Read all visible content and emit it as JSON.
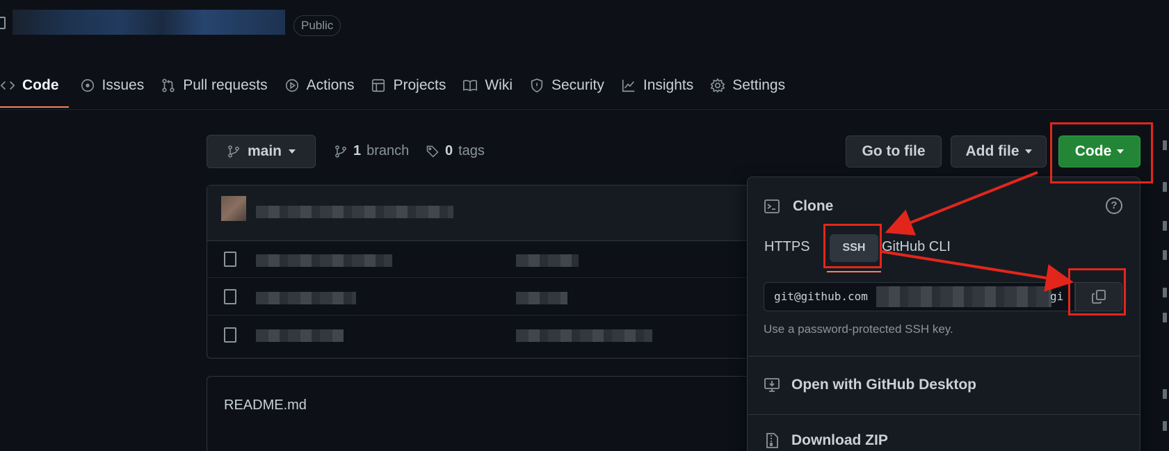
{
  "repo": {
    "visibility": "Public"
  },
  "tabs": [
    {
      "label": "Code",
      "icon": "code-icon",
      "active": true
    },
    {
      "label": "Issues",
      "icon": "issue-circle-icon"
    },
    {
      "label": "Pull requests",
      "icon": "pull-request-icon"
    },
    {
      "label": "Actions",
      "icon": "play-icon"
    },
    {
      "label": "Projects",
      "icon": "table-icon"
    },
    {
      "label": "Wiki",
      "icon": "book-icon"
    },
    {
      "label": "Security",
      "icon": "shield-icon"
    },
    {
      "label": "Insights",
      "icon": "graph-icon"
    },
    {
      "label": "Settings",
      "icon": "gear-icon"
    }
  ],
  "branch_bar": {
    "branch": "main",
    "branch_count": "1",
    "branch_label": "branch",
    "tag_count": "0",
    "tag_label": "tags",
    "goto_file": "Go to file",
    "add_file": "Add file",
    "code": "Code"
  },
  "readme": {
    "title": "README.md"
  },
  "clone_dropdown": {
    "title": "Clone",
    "protocols": [
      "HTTPS",
      "SSH",
      "GitHub CLI"
    ],
    "selected_protocol": "SSH",
    "url_prefix": "git@github.com",
    "url_suffix": "gi",
    "hint": "Use a password-protected SSH key.",
    "open_desktop": "Open with GitHub Desktop",
    "download_zip": "Download ZIP"
  },
  "colors": {
    "background": "#0d1117",
    "accent_green": "#238636",
    "underline_orange": "#f78166",
    "annotation_red": "#e3261b"
  }
}
